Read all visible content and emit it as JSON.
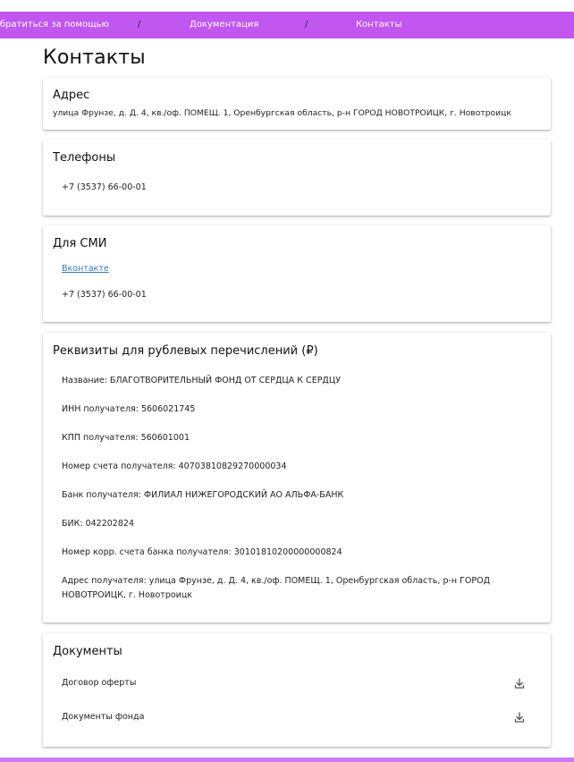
{
  "breadcrumbs": {
    "item1": "Обратиться за помощью",
    "sep1": "/",
    "item2": "Документация",
    "sep2": "/",
    "item3": "Контакты"
  },
  "page_title": "Контакты",
  "address": {
    "title": "Адрес",
    "text": "улица Фрунзе, д. Д. 4, кв./оф. ПОМЕЩ. 1, Оренбургская область, р-н ГОРОД НОВОТРОИЦК, г. Новотроицк"
  },
  "phones": {
    "title": "Телефоны",
    "items": [
      "+7 (3537) 66-00-01"
    ]
  },
  "media": {
    "title": "Для СМИ",
    "link": "Вконтакте",
    "phone": "+7 (3537) 66-00-01"
  },
  "requisites": {
    "title": "Реквизиты для рублевых перечислений (₽)",
    "lines": [
      "Название: БЛАГОТВОРИТЕЛЬНЫЙ ФОНД ОТ СЕРДЦА К СЕРДЦУ",
      "ИНН получателя: 5606021745",
      "КПП получателя: 560601001",
      "Номер счета получателя: 40703810829270000034",
      "Банк получателя: ФИЛИАЛ НИЖЕГОРОДСКИЙ АО АЛЬФА-БАНК",
      "БИК: 042202824",
      "Номер корр. счета банка получателя: 30101810200000000824"
    ],
    "address_line1": "Адрес получателя: улица Фрунзе, д. Д. 4, кв./оф. ПОМЕЩ. 1, Оренбургская область, р-н ГОРОД",
    "address_line2": "НОВОТРОИЦК, г. Новотроицк"
  },
  "documents": {
    "title": "Документы",
    "items": [
      {
        "label": "Договор оферты",
        "icon": "download-icon"
      },
      {
        "label": "Документы фонда",
        "icon": "download-icon"
      }
    ]
  },
  "colors": {
    "accent": "#c156f0",
    "link": "#3a78c2"
  }
}
